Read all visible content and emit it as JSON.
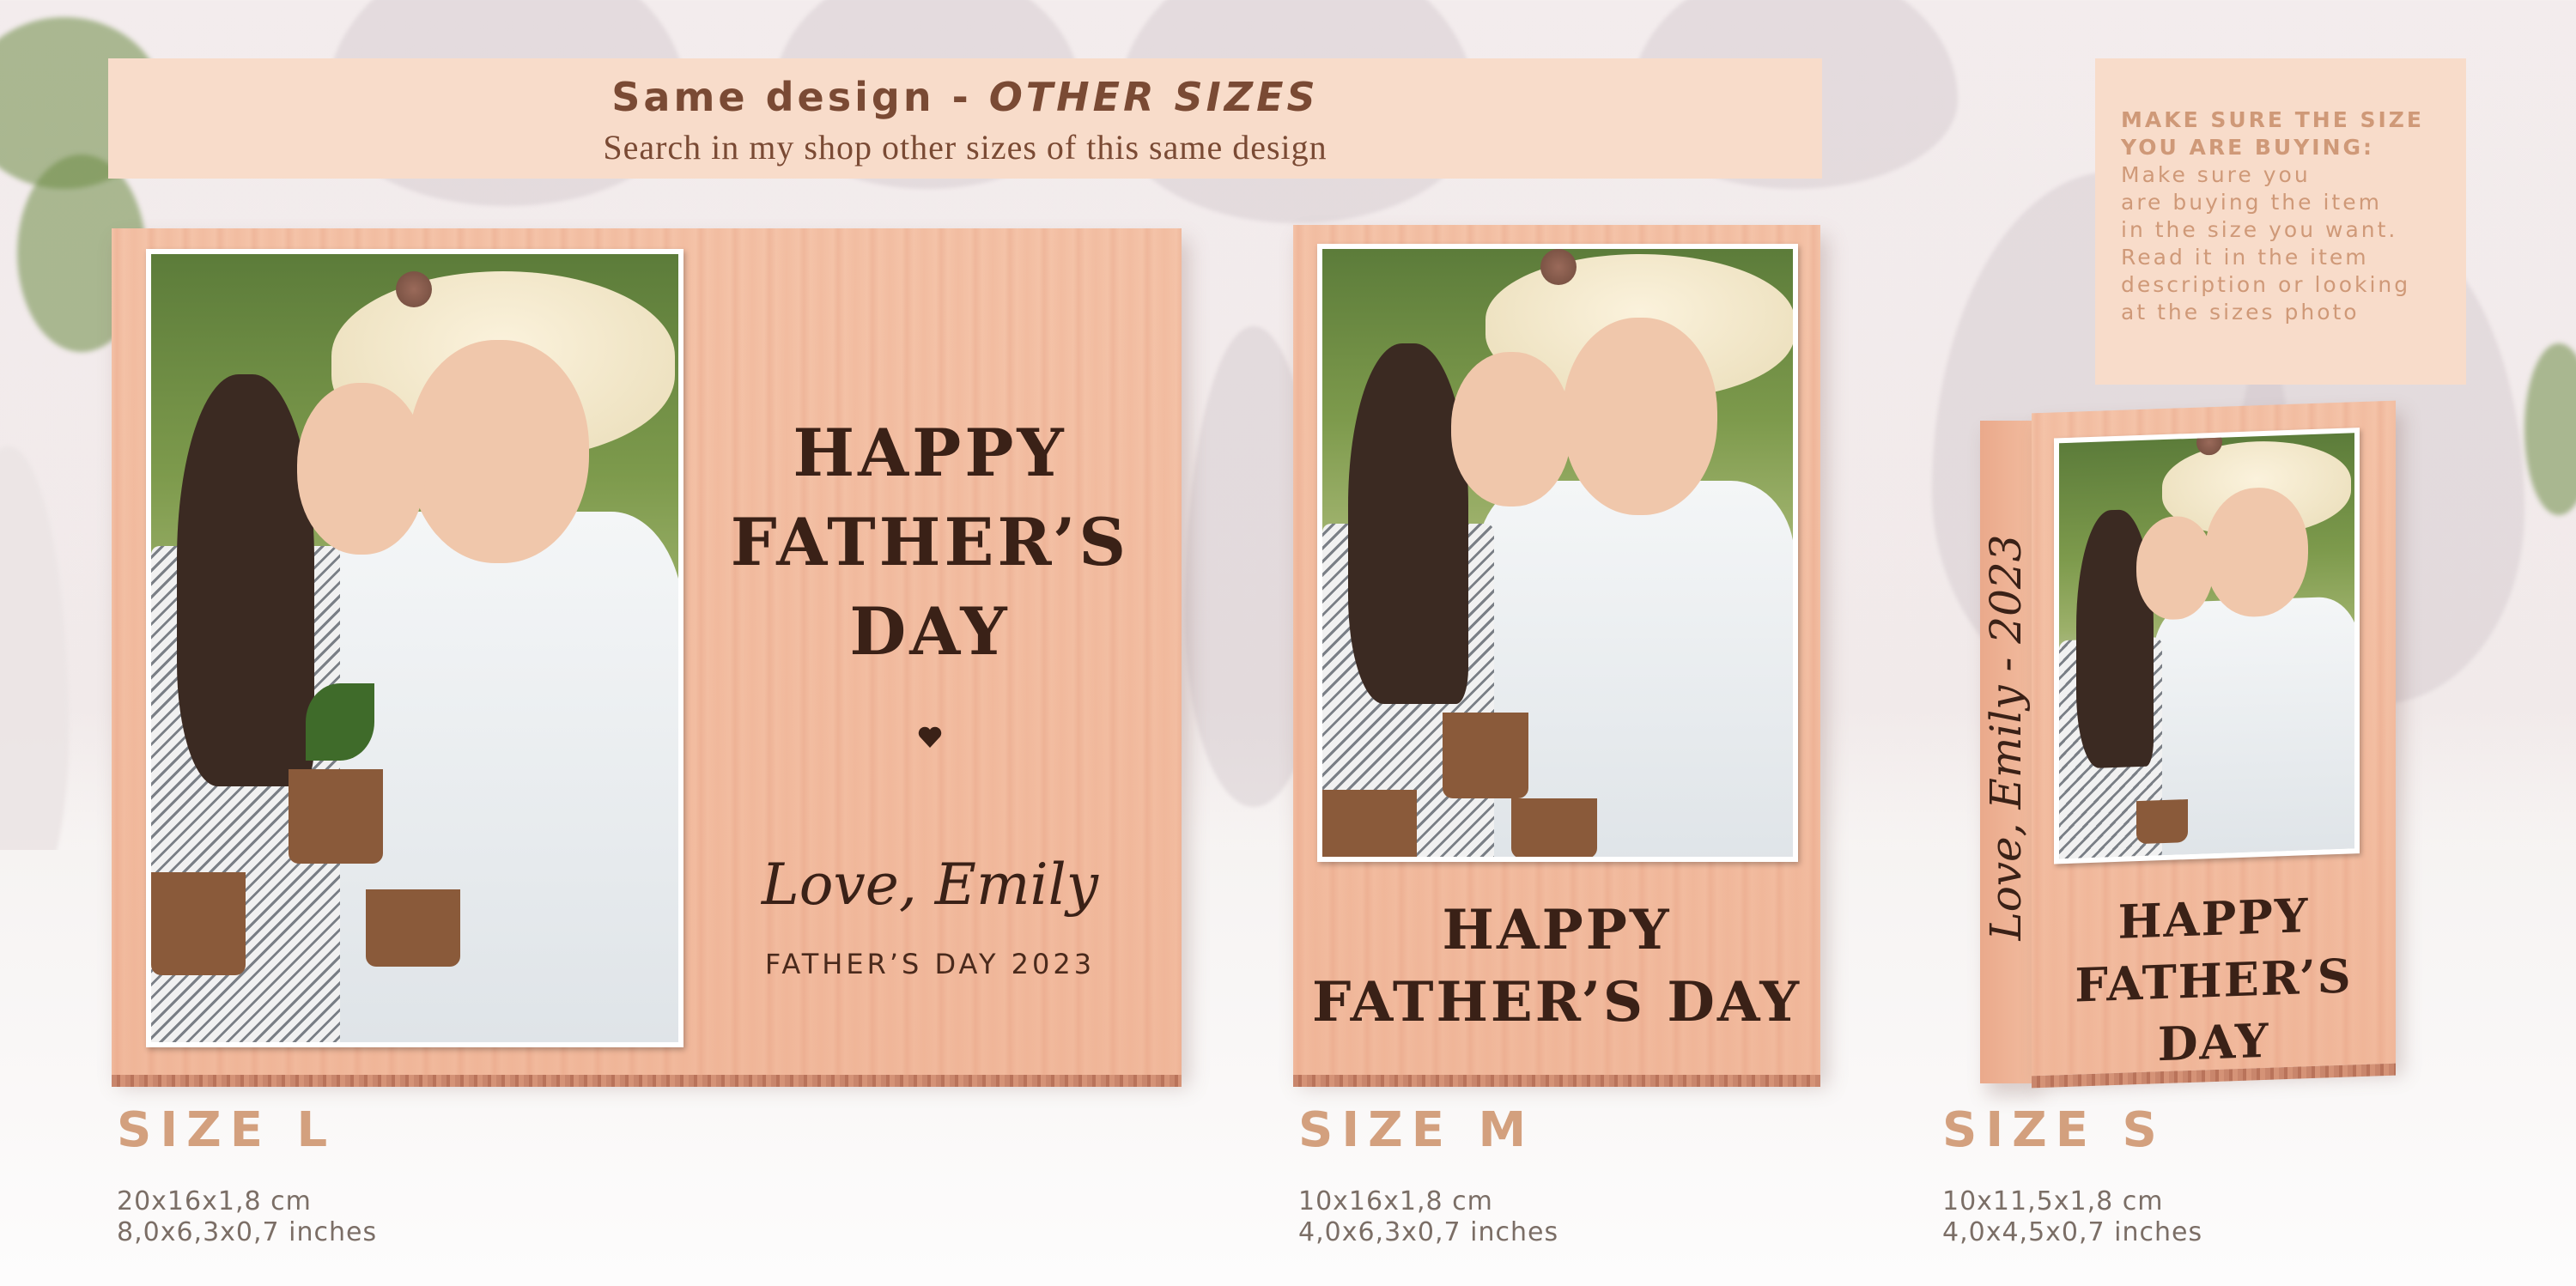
{
  "banner": {
    "title_plain": "Same design - ",
    "title_italic": "OTHER SIZES",
    "subtitle": "Search in my shop other sizes of this same design"
  },
  "note": {
    "heading_line1": "MAKE SURE THE SIZE",
    "heading_line2": "YOU ARE BUYING:",
    "body_lines": [
      "Make sure you",
      "are buying the item",
      "in the size you want.",
      "Read it in the item",
      "description or looking",
      "at the sizes photo"
    ]
  },
  "products": {
    "large": {
      "heading_lines": [
        "HAPPY",
        "FATHER’S",
        "DAY"
      ],
      "signature": "Love, Emily",
      "footer": "FATHER’S DAY 2023",
      "size_label": "SIZE L",
      "dims_cm": "20x16x1,8 cm",
      "dims_in": "8,0x6,3x0,7 inches"
    },
    "medium": {
      "heading_lines": [
        "HAPPY",
        "FATHER’S DAY"
      ],
      "size_label": "SIZE M",
      "dims_cm": "10x16x1,8 cm",
      "dims_in": "4,0x6,3x0,7 inches"
    },
    "small": {
      "side_text": "Love, Emily  -  2023",
      "heading_lines": [
        "HAPPY",
        "FATHER’S DAY"
      ],
      "size_label": "SIZE S",
      "dims_cm": "10x11,5x1,8 cm",
      "dims_in": "4,0x4,5x0,7 inches"
    }
  },
  "colors": {
    "banner_bg": "#f8dcca",
    "banner_text": "#7a4a34",
    "note_text": "#cf9978",
    "size_label": "#d3a07e",
    "engraving": "#3a2117"
  }
}
